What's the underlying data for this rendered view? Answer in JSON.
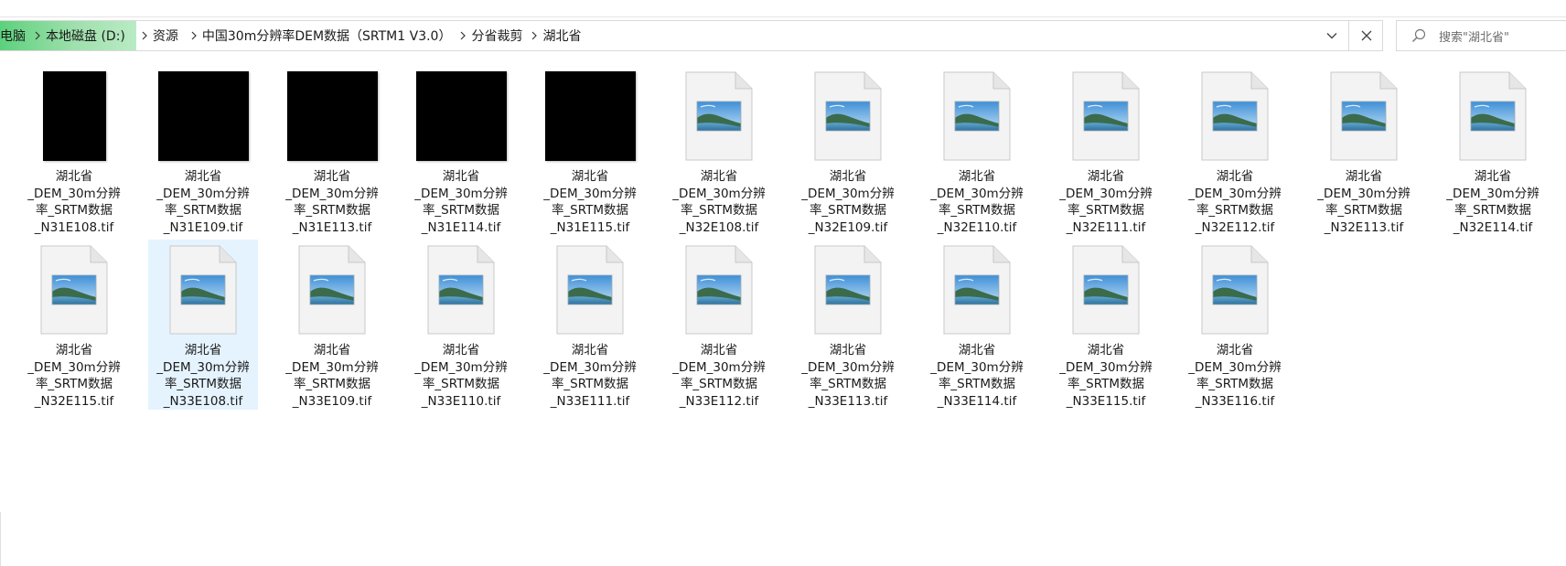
{
  "breadcrumb": {
    "items": [
      "电脑",
      "本地磁盘 (D:)",
      "资源",
      "中国30m分辨率DEM数据（SRTM1 V3.0）",
      "分省裁剪",
      "湖北省"
    ]
  },
  "search": {
    "placeholder": "搜索\"湖北省\""
  },
  "colors": {
    "progress_green": "#5cd17c",
    "selection": "#e5f3ff",
    "border": "#d9d9d9"
  },
  "files": [
    {
      "line1": "湖北省",
      "line2": "_DEM_30m分辨",
      "line3": "率_SRTM数据",
      "line4": "_N31E108.tif",
      "thumb": "black-narrow"
    },
    {
      "line1": "湖北省",
      "line2": "_DEM_30m分辨",
      "line3": "率_SRTM数据",
      "line4": "_N31E109.tif",
      "thumb": "black-wide"
    },
    {
      "line1": "湖北省",
      "line2": "_DEM_30m分辨",
      "line3": "率_SRTM数据",
      "line4": "_N31E113.tif",
      "thumb": "black-wide"
    },
    {
      "line1": "湖北省",
      "line2": "_DEM_30m分辨",
      "line3": "率_SRTM数据",
      "line4": "_N31E114.tif",
      "thumb": "black-wide"
    },
    {
      "line1": "湖北省",
      "line2": "_DEM_30m分辨",
      "line3": "率_SRTM数据",
      "line4": "_N31E115.tif",
      "thumb": "black-wide"
    },
    {
      "line1": "湖北省",
      "line2": "_DEM_30m分辨",
      "line3": "率_SRTM数据",
      "line4": "_N32E108.tif",
      "thumb": "image-file-icon"
    },
    {
      "line1": "湖北省",
      "line2": "_DEM_30m分辨",
      "line3": "率_SRTM数据",
      "line4": "_N32E109.tif",
      "thumb": "image-file-icon"
    },
    {
      "line1": "湖北省",
      "line2": "_DEM_30m分辨",
      "line3": "率_SRTM数据",
      "line4": "_N32E110.tif",
      "thumb": "image-file-icon"
    },
    {
      "line1": "湖北省",
      "line2": "_DEM_30m分辨",
      "line3": "率_SRTM数据",
      "line4": "_N32E111.tif",
      "thumb": "image-file-icon"
    },
    {
      "line1": "湖北省",
      "line2": "_DEM_30m分辨",
      "line3": "率_SRTM数据",
      "line4": "_N32E112.tif",
      "thumb": "image-file-icon"
    },
    {
      "line1": "湖北省",
      "line2": "_DEM_30m分辨",
      "line3": "率_SRTM数据",
      "line4": "_N32E113.tif",
      "thumb": "image-file-icon"
    },
    {
      "line1": "湖北省",
      "line2": "_DEM_30m分辨",
      "line3": "率_SRTM数据",
      "line4": "_N32E114.tif",
      "thumb": "image-file-icon"
    },
    {
      "line1": "湖北省",
      "line2": "_DEM_30m分辨",
      "line3": "率_SRTM数据",
      "line4": "_N32E115.tif",
      "thumb": "image-file-icon"
    },
    {
      "line1": "湖北省",
      "line2": "_DEM_30m分辨",
      "line3": "率_SRTM数据",
      "line4": "_N33E108.tif",
      "thumb": "image-file-icon",
      "selected": true
    },
    {
      "line1": "湖北省",
      "line2": "_DEM_30m分辨",
      "line3": "率_SRTM数据",
      "line4": "_N33E109.tif",
      "thumb": "image-file-icon"
    },
    {
      "line1": "湖北省",
      "line2": "_DEM_30m分辨",
      "line3": "率_SRTM数据",
      "line4": "_N33E110.tif",
      "thumb": "image-file-icon"
    },
    {
      "line1": "湖北省",
      "line2": "_DEM_30m分辨",
      "line3": "率_SRTM数据",
      "line4": "_N33E111.tif",
      "thumb": "image-file-icon"
    },
    {
      "line1": "湖北省",
      "line2": "_DEM_30m分辨",
      "line3": "率_SRTM数据",
      "line4": "_N33E112.tif",
      "thumb": "image-file-icon"
    },
    {
      "line1": "湖北省",
      "line2": "_DEM_30m分辨",
      "line3": "率_SRTM数据",
      "line4": "_N33E113.tif",
      "thumb": "image-file-icon"
    },
    {
      "line1": "湖北省",
      "line2": "_DEM_30m分辨",
      "line3": "率_SRTM数据",
      "line4": "_N33E114.tif",
      "thumb": "image-file-icon"
    },
    {
      "line1": "湖北省",
      "line2": "_DEM_30m分辨",
      "line3": "率_SRTM数据",
      "line4": "_N33E115.tif",
      "thumb": "image-file-icon"
    },
    {
      "line1": "湖北省",
      "line2": "_DEM_30m分辨",
      "line3": "率_SRTM数据",
      "line4": "_N33E116.tif",
      "thumb": "image-file-icon"
    }
  ]
}
